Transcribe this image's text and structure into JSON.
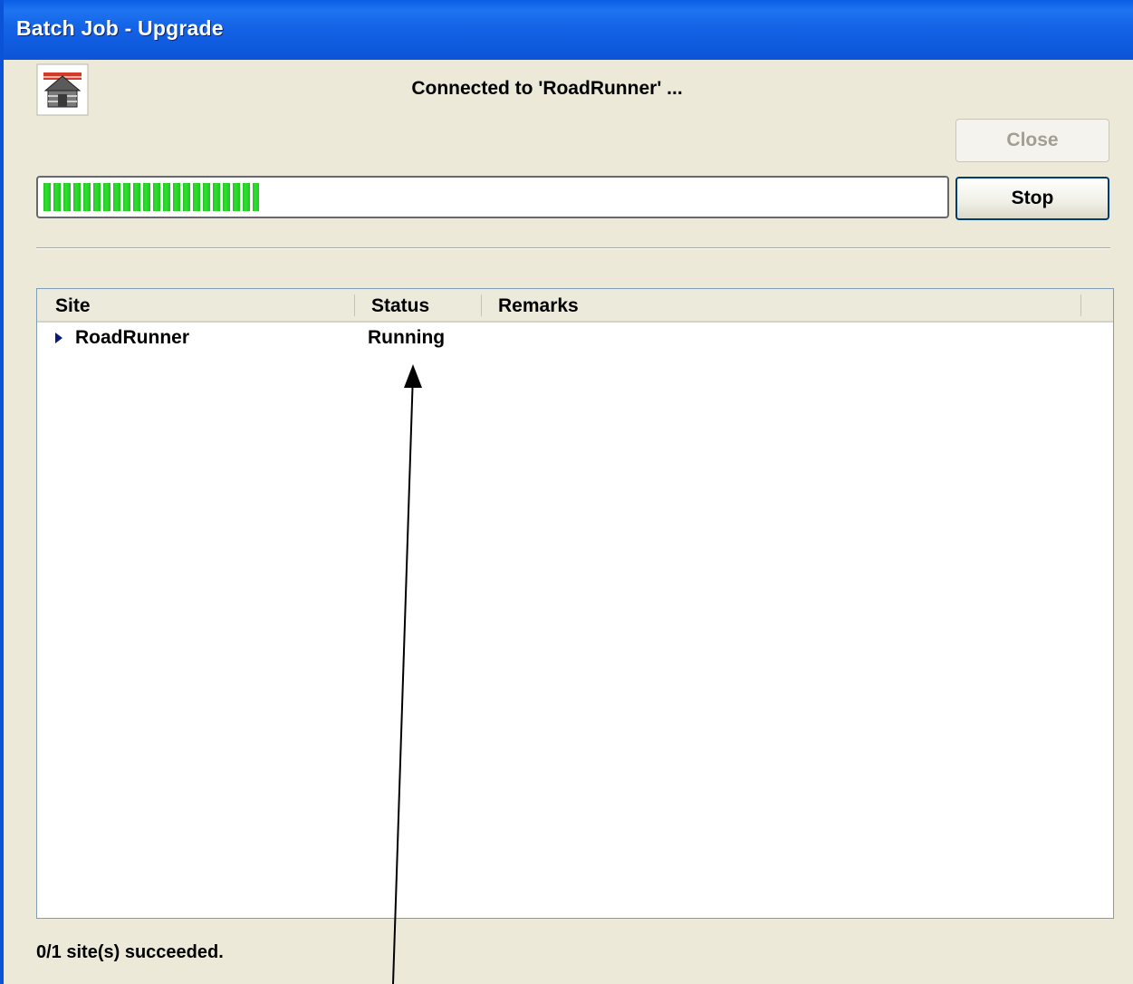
{
  "window": {
    "title": "Batch Job - Upgrade"
  },
  "header": {
    "connected_text": "Connected to 'RoadRunner' ...",
    "icon": "upgrade-house-icon"
  },
  "buttons": {
    "close_label": "Close",
    "close_enabled": false,
    "stop_label": "Stop"
  },
  "progress": {
    "fraction": 0.24,
    "color": "#22c322"
  },
  "list": {
    "columns": [
      "Site",
      "Status",
      "Remarks"
    ],
    "rows": [
      {
        "site": "RoadRunner",
        "status": "Running",
        "remarks": ""
      }
    ]
  },
  "status_bar": {
    "text": "0/1 site(s) succeeded."
  },
  "colors": {
    "titlebar": "#0a5ee6",
    "window_bg": "#ece9d8",
    "progress_green": "#22c322"
  }
}
